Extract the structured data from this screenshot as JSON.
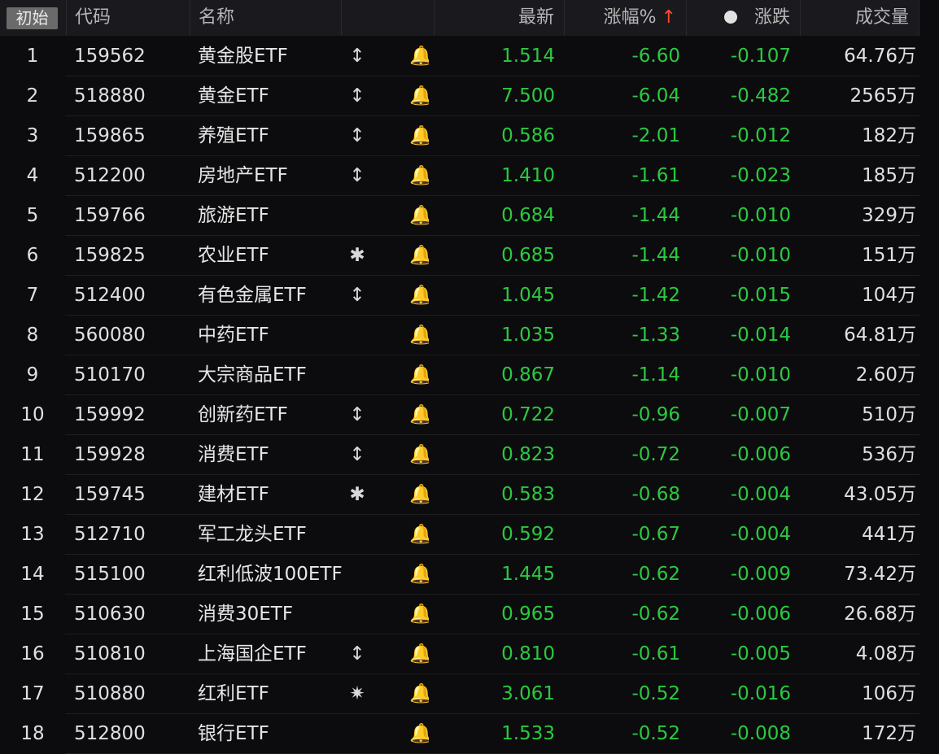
{
  "header": {
    "reset_label": "初始",
    "code_label": "代码",
    "name_label": "名称",
    "latest_label": "最新",
    "pct_label": "涨幅%",
    "sort_arrow": "↑",
    "change_label": "涨跌",
    "volume_label": "成交量"
  },
  "colors": {
    "down": "#2bc93f",
    "sort_arrow": "#ff4a2a",
    "header_bg": "#1a1a1e",
    "page_bg": "#0c0c0f"
  },
  "rows": [
    {
      "idx": "1",
      "code": "159562",
      "name": "黄金股ETF",
      "flag": "↕",
      "flag_icon": "updown-icon",
      "bell": "🔔",
      "latest": "1.514",
      "pct": "-6.60",
      "change": "-0.107",
      "volume": "64.76万"
    },
    {
      "idx": "2",
      "code": "518880",
      "name": "黄金ETF",
      "flag": "↕",
      "flag_icon": "updown-icon",
      "bell": "🔔",
      "latest": "7.500",
      "pct": "-6.04",
      "change": "-0.482",
      "volume": "2565万"
    },
    {
      "idx": "3",
      "code": "159865",
      "name": "养殖ETF",
      "flag": "↕",
      "flag_icon": "updown-icon",
      "bell": "🔔",
      "latest": "0.586",
      "pct": "-2.01",
      "change": "-0.012",
      "volume": "182万"
    },
    {
      "idx": "4",
      "code": "512200",
      "name": "房地产ETF",
      "flag": "↕",
      "flag_icon": "updown-icon",
      "bell": "🔔",
      "latest": "1.410",
      "pct": "-1.61",
      "change": "-0.023",
      "volume": "185万"
    },
    {
      "idx": "5",
      "code": "159766",
      "name": "旅游ETF",
      "flag": "",
      "flag_icon": "",
      "bell": "🔔",
      "latest": "0.684",
      "pct": "-1.44",
      "change": "-0.010",
      "volume": "329万"
    },
    {
      "idx": "6",
      "code": "159825",
      "name": "农业ETF",
      "flag": "✱",
      "flag_icon": "burst-icon",
      "bell": "🔔",
      "latest": "0.685",
      "pct": "-1.44",
      "change": "-0.010",
      "volume": "151万"
    },
    {
      "idx": "7",
      "code": "512400",
      "name": "有色金属ETF",
      "flag": "↕",
      "flag_icon": "updown-icon",
      "bell": "🔔",
      "latest": "1.045",
      "pct": "-1.42",
      "change": "-0.015",
      "volume": "104万"
    },
    {
      "idx": "8",
      "code": "560080",
      "name": "中药ETF",
      "flag": "",
      "flag_icon": "",
      "bell": "🔔",
      "latest": "1.035",
      "pct": "-1.33",
      "change": "-0.014",
      "volume": "64.81万"
    },
    {
      "idx": "9",
      "code": "510170",
      "name": "大宗商品ETF",
      "flag": "",
      "flag_icon": "",
      "bell": "🔔",
      "latest": "0.867",
      "pct": "-1.14",
      "change": "-0.010",
      "volume": "2.60万"
    },
    {
      "idx": "10",
      "code": "159992",
      "name": "创新药ETF",
      "flag": "↕",
      "flag_icon": "updown-icon",
      "bell": "🔔",
      "latest": "0.722",
      "pct": "-0.96",
      "change": "-0.007",
      "volume": "510万"
    },
    {
      "idx": "11",
      "code": "159928",
      "name": "消费ETF",
      "flag": "↕",
      "flag_icon": "updown-icon",
      "bell": "🔔",
      "latest": "0.823",
      "pct": "-0.72",
      "change": "-0.006",
      "volume": "536万"
    },
    {
      "idx": "12",
      "code": "159745",
      "name": "建材ETF",
      "flag": "✱",
      "flag_icon": "burst-icon",
      "bell": "🔔",
      "latest": "0.583",
      "pct": "-0.68",
      "change": "-0.004",
      "volume": "43.05万"
    },
    {
      "idx": "13",
      "code": "512710",
      "name": "军工龙头ETF",
      "flag": "",
      "flag_icon": "",
      "bell": "🔔",
      "latest": "0.592",
      "pct": "-0.67",
      "change": "-0.004",
      "volume": "441万"
    },
    {
      "idx": "14",
      "code": "515100",
      "name": "红利低波100ETF",
      "flag": "",
      "flag_icon": "",
      "bell": "🔔",
      "latest": "1.445",
      "pct": "-0.62",
      "change": "-0.009",
      "volume": "73.42万"
    },
    {
      "idx": "15",
      "code": "510630",
      "name": "消费30ETF",
      "flag": "",
      "flag_icon": "",
      "bell": "🔔",
      "latest": "0.965",
      "pct": "-0.62",
      "change": "-0.006",
      "volume": "26.68万"
    },
    {
      "idx": "16",
      "code": "510810",
      "name": "上海国企ETF",
      "flag": "↕",
      "flag_icon": "updown-icon",
      "bell": "🔔",
      "latest": "0.810",
      "pct": "-0.61",
      "change": "-0.005",
      "volume": "4.08万"
    },
    {
      "idx": "17",
      "code": "510880",
      "name": "红利ETF",
      "flag": "✷",
      "flag_icon": "sun-icon",
      "bell": "🔔",
      "latest": "3.061",
      "pct": "-0.52",
      "change": "-0.016",
      "volume": "106万"
    },
    {
      "idx": "18",
      "code": "512800",
      "name": "银行ETF",
      "flag": "",
      "flag_icon": "",
      "bell": "🔔",
      "latest": "1.533",
      "pct": "-0.52",
      "change": "-0.008",
      "volume": "172万"
    }
  ]
}
